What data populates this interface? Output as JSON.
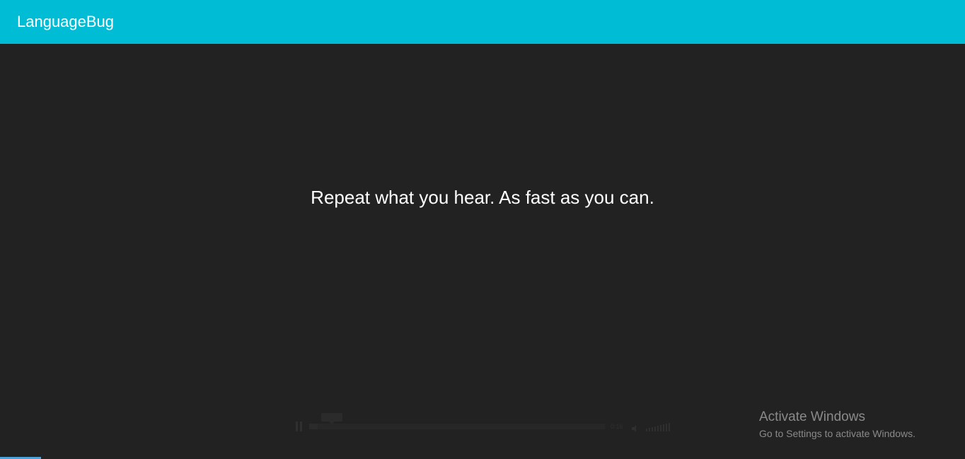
{
  "header": {
    "title": "LanguageBug",
    "bar_color": "#00bcd4"
  },
  "main": {
    "prompt": "Repeat what you hear. As fast as you can."
  },
  "player": {
    "play_state": "pause-icon",
    "time": "0:16"
  },
  "windows_watermark": {
    "title": "Activate Windows",
    "subtitle": "Go to Settings to activate Windows."
  },
  "colors": {
    "background": "#222222",
    "accent": "#00bcd4",
    "text": "#ffffff"
  }
}
